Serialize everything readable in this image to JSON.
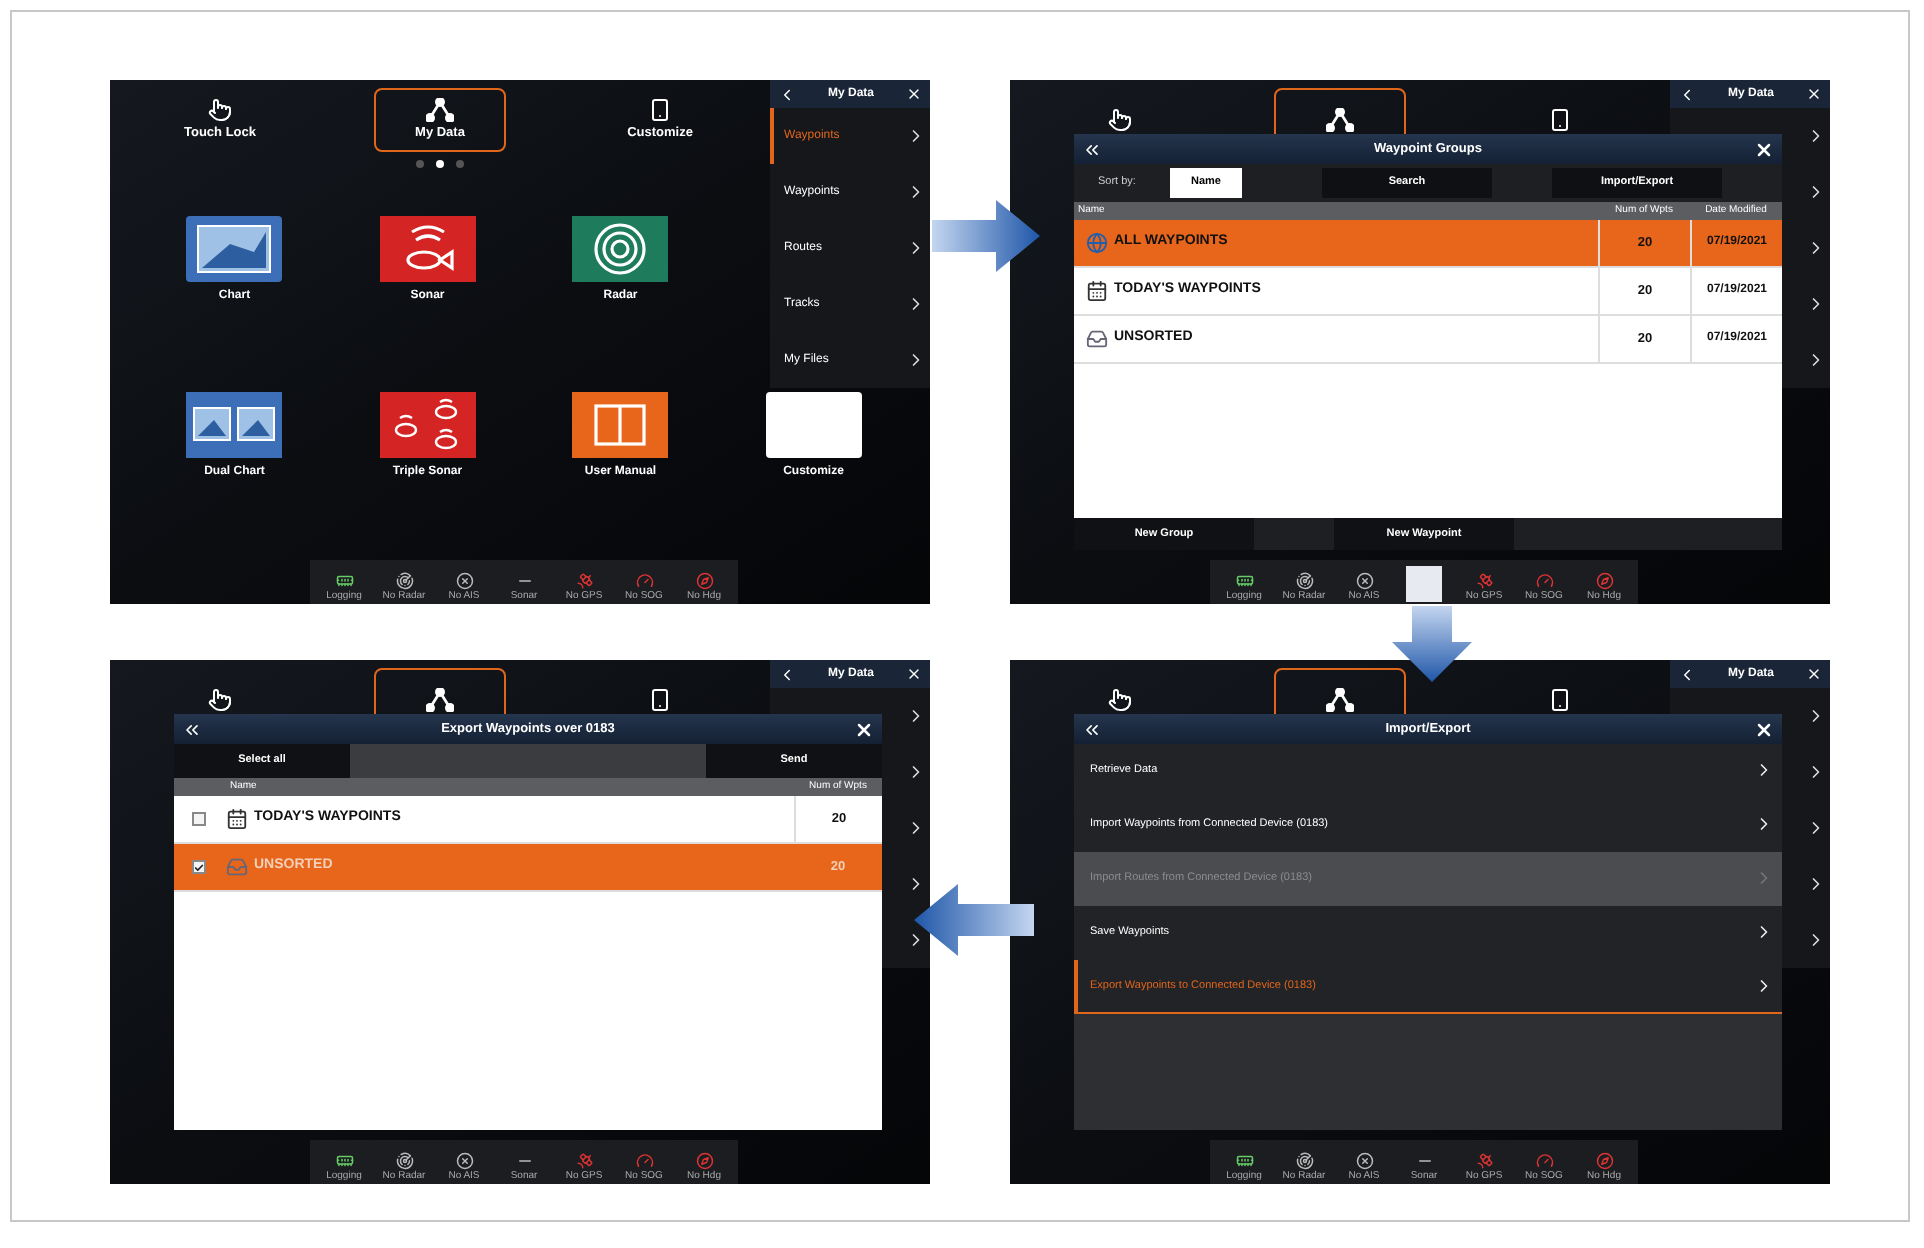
{
  "panels": [
    {
      "kind": "home",
      "home_bar": [
        {
          "label": "Touch Lock",
          "selected": false
        },
        {
          "label": "My Data",
          "selected": true
        },
        {
          "label": "Customize",
          "selected": false
        }
      ],
      "page_dots": [
        {
          "selected": false
        },
        {
          "selected": true
        },
        {
          "selected": false
        }
      ],
      "apps": [
        [
          {
            "label": "Chart",
            "kind": "chart"
          },
          {
            "label": "Sonar",
            "kind": "sonar"
          },
          {
            "label": "Radar",
            "kind": "radar"
          }
        ],
        [
          {
            "label": "Dual Chart",
            "kind": "dual_chart"
          },
          {
            "label": "Triple Sonar",
            "kind": "triple_sonar"
          },
          {
            "label": "User Manual",
            "kind": "manual"
          },
          {
            "label": "Customize",
            "kind": "blank"
          }
        ]
      ],
      "side_menu": {
        "title": "My Data",
        "items": [
          {
            "label": "Waypoints",
            "selected": true
          },
          {
            "label": "Waypoints",
            "selected": false
          },
          {
            "label": "Routes",
            "selected": false
          },
          {
            "label": "Tracks",
            "selected": false
          },
          {
            "label": "My Files",
            "selected": false
          }
        ]
      },
      "status_bar": [
        {
          "kind": "logging",
          "label": "Logging"
        },
        {
          "kind": "radar",
          "label": "No Radar"
        },
        {
          "kind": "ais",
          "label": "No AIS"
        },
        {
          "kind": "sonar",
          "label": "Sonar"
        },
        {
          "kind": "gps",
          "label": "No GPS"
        },
        {
          "kind": "sog",
          "label": "No SOG"
        },
        {
          "kind": "hdg",
          "label": "No Hdg"
        }
      ]
    },
    {
      "kind": "groups",
      "home_bar": [
        {
          "selected": false
        },
        {
          "selected": true
        },
        {
          "selected": false
        }
      ],
      "side_menu": {
        "title": "My Data"
      },
      "dialog": {
        "title": "Waypoint Groups",
        "sort_label": "Sort by:",
        "tabs": [
          {
            "label": "Name",
            "selected": true
          },
          {
            "label": "Search",
            "selected": false
          },
          {
            "label": "Import/Export",
            "selected": false
          }
        ],
        "columns": [
          "Name",
          "Num of Wpts",
          "Date Modified"
        ],
        "rows": [
          {
            "kind": "all",
            "name": "ALL WAYPOINTS",
            "count": "20",
            "date": "07/19/2021",
            "selected": true
          },
          {
            "kind": "dated",
            "name": "TODAY'S WAYPOINTS",
            "count": "20",
            "date": "07/19/2021",
            "selected": false
          },
          {
            "kind": "unsorted",
            "name": "UNSORTED",
            "count": "20",
            "date": "07/19/2021",
            "selected": false
          }
        ],
        "buttons": [
          "New Group",
          "New Waypoint"
        ]
      },
      "status_bar": [
        {
          "kind": "logging",
          "label": "Logging"
        },
        {
          "kind": "radar",
          "label": "No Radar"
        },
        {
          "kind": "ais",
          "label": "No AIS"
        },
        {
          "kind": "blank"
        },
        {
          "kind": "gps",
          "label": "No GPS"
        },
        {
          "kind": "sog",
          "label": "No SOG"
        },
        {
          "kind": "hdg",
          "label": "No Hdg"
        }
      ]
    },
    {
      "kind": "export",
      "home_bar": [
        {
          "selected": false
        },
        {
          "selected": true
        },
        {
          "selected": false
        }
      ],
      "side_menu": {
        "title": "My Data"
      },
      "dialog": {
        "title": "Export Waypoints over 0183",
        "buttons": [
          "Select all",
          "Send"
        ],
        "columns": [
          "Name",
          "Num of Wpts"
        ],
        "rows": [
          {
            "kind": "dated",
            "name": "TODAY'S WAYPOINTS",
            "count": "20",
            "checked": false,
            "selected": false
          },
          {
            "kind": "unsorted",
            "name": "UNSORTED",
            "count": "20",
            "checked": true,
            "selected": true
          }
        ]
      },
      "status_bar": [
        {
          "kind": "logging",
          "label": "Logging"
        },
        {
          "kind": "radar",
          "label": "No Radar"
        },
        {
          "kind": "ais",
          "label": "No AIS"
        },
        {
          "kind": "sonar",
          "label": "Sonar"
        },
        {
          "kind": "gps",
          "label": "No GPS"
        },
        {
          "kind": "sog",
          "label": "No SOG"
        },
        {
          "kind": "hdg",
          "label": "No Hdg"
        }
      ]
    },
    {
      "kind": "menu",
      "home_bar": [
        {
          "selected": false
        },
        {
          "selected": true
        },
        {
          "selected": false
        }
      ],
      "side_menu": {
        "title": "My Data"
      },
      "dialog": {
        "title": "Import/Export",
        "items": [
          {
            "label": "Retrieve Data",
            "disabled": false,
            "selected": false
          },
          {
            "label": "Import Waypoints from Connected Device (0183)",
            "disabled": false,
            "selected": false
          },
          {
            "label": "Import Routes from Connected Device (0183)",
            "disabled": true,
            "selected": false
          },
          {
            "label": "Save Waypoints",
            "disabled": false,
            "selected": false
          },
          {
            "label": "Export Waypoints to Connected Device (0183)",
            "disabled": false,
            "selected": true
          }
        ]
      },
      "status_bar": [
        {
          "kind": "logging",
          "label": "Logging"
        },
        {
          "kind": "radar",
          "label": "No Radar"
        },
        {
          "kind": "ais",
          "label": "No AIS"
        },
        {
          "kind": "sonar",
          "label": "Sonar"
        },
        {
          "kind": "gps",
          "label": "No GPS"
        },
        {
          "kind": "sog",
          "label": "No SOG"
        },
        {
          "kind": "hdg",
          "label": "No Hdg"
        }
      ]
    }
  ]
}
